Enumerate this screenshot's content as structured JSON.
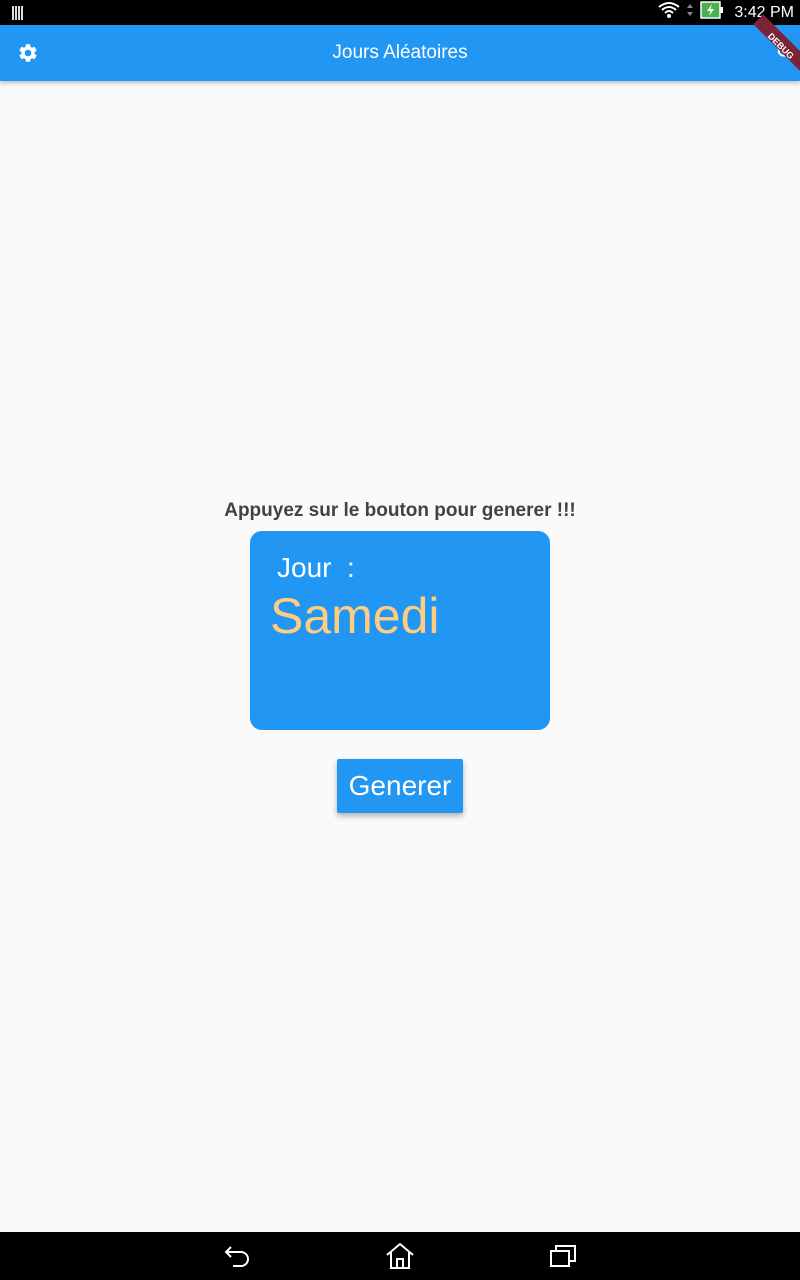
{
  "status_bar": {
    "time": "3:42 PM",
    "icons": [
      "sim-card-icon",
      "wifi-icon",
      "battery-charging-icon"
    ]
  },
  "app_bar": {
    "title": "Jours Aléatoires",
    "left_icon": "settings-icon",
    "right_icon": "search-icon",
    "debug_banner": "DEBUG"
  },
  "main": {
    "instruction": "Appuyez sur le bouton pour generer !!!",
    "card": {
      "label": "Jour  :",
      "value": "Samedi"
    },
    "button_label": "Generer"
  },
  "nav_bar": {
    "icons": [
      "back-icon",
      "home-icon",
      "recent-apps-icon"
    ]
  },
  "colors": {
    "primary": "#2196f3",
    "accent_text": "#ffcc80",
    "background": "#fafafa",
    "body_text": "#424242"
  }
}
